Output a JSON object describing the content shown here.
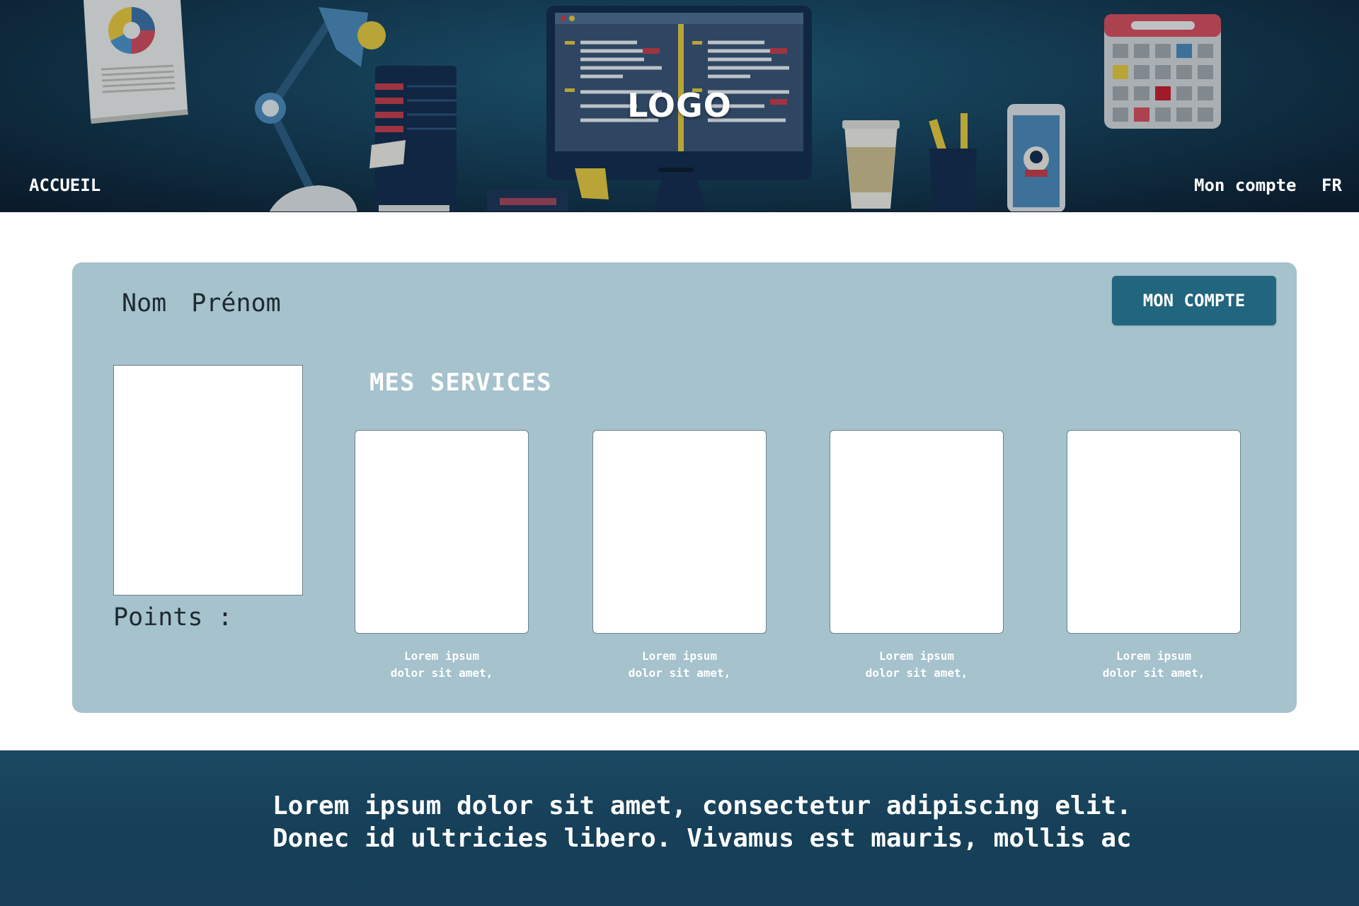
{
  "header": {
    "logo": "LOGO",
    "nav": {
      "home": "ACCUEIL",
      "account": "Mon compte",
      "language": "FR"
    },
    "icons": [
      "report-icon",
      "desk-lamp-icon",
      "server-rack-icon",
      "monitor-icon",
      "coffee-cup-icon",
      "pencil-cup-icon",
      "smartphone-icon",
      "calendar-icon"
    ]
  },
  "profile": {
    "name": "Nom  Prénom",
    "points_label": "Points :",
    "account_button": "MON COMPTE"
  },
  "services": {
    "title": "MES SERVICES",
    "items": [
      {
        "line1": "Lorem ipsum",
        "line2": "dolor sit amet,"
      },
      {
        "line1": "Lorem ipsum",
        "line2": "dolor sit amet,"
      },
      {
        "line1": "Lorem ipsum",
        "line2": "dolor sit amet,"
      },
      {
        "line1": "Lorem ipsum",
        "line2": "dolor sit amet,"
      }
    ]
  },
  "footer": {
    "line1": "Lorem ipsum dolor sit amet, consectetur adipiscing elit.",
    "line2": "Donec id ultricies libero. Vivamus est mauris, mollis ac"
  },
  "colors": {
    "card_bg": "#a5c2cd",
    "button_bg": "#22657e",
    "footer_bg": "#163f58",
    "header_bg": "#163f58"
  }
}
